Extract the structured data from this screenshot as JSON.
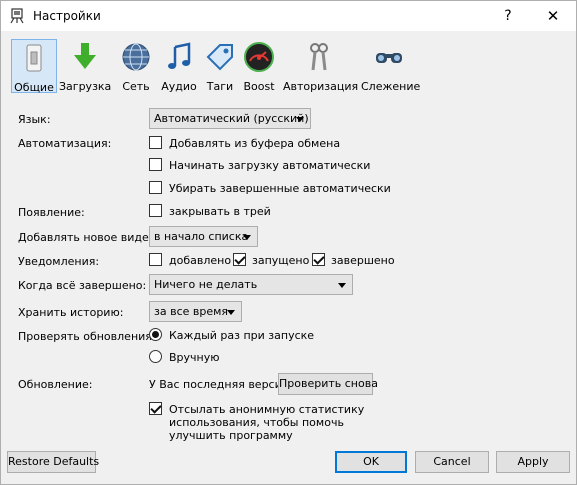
{
  "window": {
    "title": "Настройки",
    "help": "?",
    "close": "✕"
  },
  "toolbar": {
    "items": [
      {
        "label": "Общие",
        "icon": "general-icon"
      },
      {
        "label": "Загрузка",
        "icon": "download-icon"
      },
      {
        "label": "Сеть",
        "icon": "network-icon"
      },
      {
        "label": "Аудио",
        "icon": "audio-icon"
      },
      {
        "label": "Таги",
        "icon": "tag-icon"
      },
      {
        "label": "Boost",
        "icon": "boost-icon"
      },
      {
        "label": "Авторизация",
        "icon": "keys-icon"
      },
      {
        "label": "Слежение",
        "icon": "binoculars-icon"
      }
    ]
  },
  "settings": {
    "language_label": "Язык:",
    "language_value": "Автоматический (русский)",
    "automation_label": "Автоматизация:",
    "auto_clipboard": "Добавлять из буфера обмена",
    "auto_start": "Начинать загрузку автоматически",
    "auto_remove": "Убирать завершенные автоматически",
    "appearance_label": "Появление:",
    "close_to_tray": "закрывать в трей",
    "add_video_label": "Добавлять новое видео:",
    "add_video_value": "в начало списка",
    "notifications_label": "Уведомления:",
    "notif_added": "добавлено",
    "notif_started": "запущено",
    "notif_finished": "завершено",
    "when_done_label": "Когда всё завершено:",
    "when_done_value": "Ничего не делать",
    "history_label": "Хранить историю:",
    "history_value": "за все время",
    "check_updates_label": "Проверять обновления:",
    "check_each_start": "Каждый раз при запуске",
    "check_manual": "Вручную",
    "update_label": "Обновление:",
    "update_status": "У Вас последняя версия",
    "check_again": "Проверить снова",
    "stats_line1": "Отсылать анонимную статистику",
    "stats_line2": "использования, чтобы помочь",
    "stats_line3": "улучшить программу"
  },
  "buttons": {
    "restore": "Restore Defaults",
    "ok": "OK",
    "cancel": "Cancel",
    "apply": "Apply"
  }
}
